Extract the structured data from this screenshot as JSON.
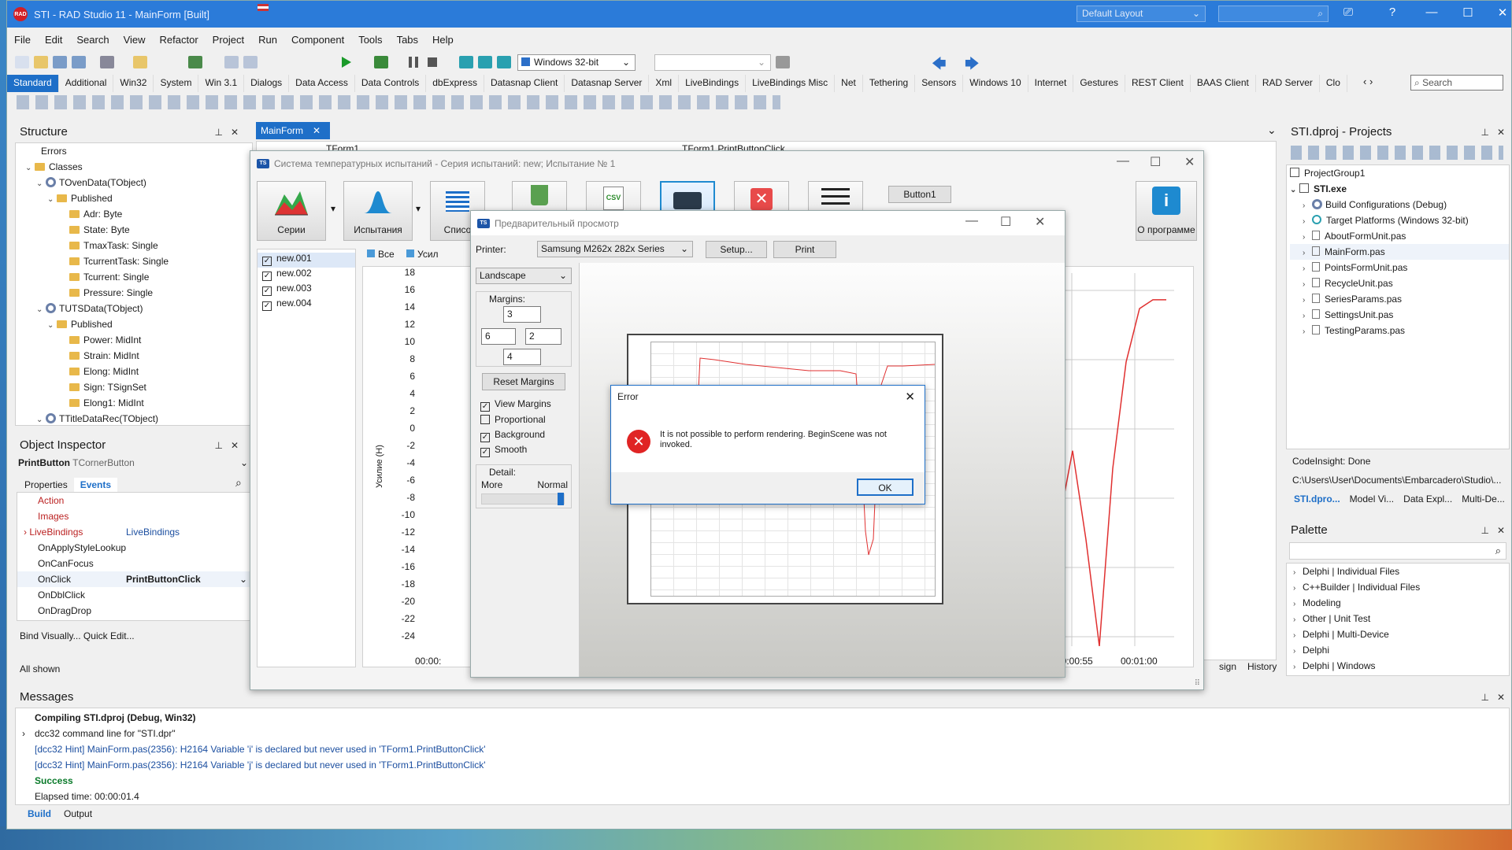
{
  "title": {
    "app": "STI - RAD Studio 11 - MainForm [Built]",
    "layout": "Default Layout",
    "logo": "RAD"
  },
  "menu": [
    "File",
    "Edit",
    "Search",
    "View",
    "Refactor",
    "Project",
    "Run",
    "Component",
    "Tools",
    "Tabs",
    "Help"
  ],
  "toolbar": {
    "platform": "Windows 32-bit",
    "search_placeholder": "Search"
  },
  "palette_tabs": [
    "Standard",
    "Additional",
    "Win32",
    "System",
    "Win 3.1",
    "Dialogs",
    "Data Access",
    "Data Controls",
    "dbExpress",
    "Datasnap Client",
    "Datasnap Server",
    "Xml",
    "LiveBindings",
    "LiveBindings Misc",
    "Net",
    "Tethering",
    "Sensors",
    "Windows 10",
    "Internet",
    "Gestures",
    "REST Client",
    "BAAS Client",
    "RAD Server",
    "Clo"
  ],
  "structure": {
    "title": "Structure",
    "items": [
      "Errors",
      "Classes",
      "TOvenData(TObject)",
      "Published",
      "Adr: Byte",
      "State: Byte",
      "TmaxTask: Single",
      "TcurrentTask: Single",
      "Tcurrent: Single",
      "Pressure: Single",
      "TUTSData(TObject)",
      "Published",
      "Power: MidInt",
      "Strain: MidInt",
      "Elong: MidInt",
      "Sign: TSignSet",
      "Elong1: MidInt",
      "TTitleDataRec(TObject)"
    ]
  },
  "inspector": {
    "title": "Object Inspector",
    "object": "PrintButton",
    "type": "TCornerButton",
    "tab_properties": "Properties",
    "tab_events": "Events",
    "rows": [
      {
        "name": "Action",
        "value": ""
      },
      {
        "name": "Images",
        "value": ""
      },
      {
        "name": "LiveBindings",
        "value": "LiveBindings"
      },
      {
        "name": "OnApplyStyleLookup",
        "value": ""
      },
      {
        "name": "OnCanFocus",
        "value": ""
      },
      {
        "name": "OnClick",
        "value": "PrintButtonClick"
      },
      {
        "name": "OnDblClick",
        "value": ""
      },
      {
        "name": "OnDragDrop",
        "value": ""
      }
    ],
    "bind": "Bind Visually... Quick Edit...",
    "shown": "All shown"
  },
  "editor": {
    "tab": "MainForm",
    "combo1": "TForm1",
    "combo2": "TForm1.PrintButtonClick",
    "bottom_tabs": [
      "sign",
      "History"
    ],
    "times": [
      "00:00:55",
      "00:01:00"
    ]
  },
  "app_window": {
    "title": "Система температурных испытаний - Серия испытаний: new; Испытание № 1",
    "buttons": {
      "series": "Серии",
      "tests": "Испытания",
      "list": "Списо",
      "about": "О программе",
      "button1": "Button1"
    },
    "files": [
      "new.001",
      "new.002",
      "new.003",
      "new.004"
    ],
    "tab_all": "Все",
    "tab_force": "Усил",
    "y_axis_label": "Усилие (Н)",
    "y_ticks": [
      "18",
      "16",
      "14",
      "12",
      "10",
      "8",
      "6",
      "4",
      "2",
      "0",
      "-2",
      "-4",
      "-6",
      "-8",
      "-10",
      "-12",
      "-14",
      "-16",
      "-18",
      "-20",
      "-22",
      "-24"
    ],
    "x_first": "00:00:"
  },
  "preview": {
    "title": "Предварительный просмотр",
    "printer_label": "Printer:",
    "printer": "Samsung M262x 282x Series",
    "setup": "Setup...",
    "print": "Print",
    "orientation": "Landscape",
    "margins_label": "Margins:",
    "m_top": "3",
    "m_left": "6",
    "m_right": "2",
    "m_bottom": "4",
    "reset": "Reset Margins",
    "view_margins": "View Margins",
    "proportional": "Proportional",
    "background": "Background",
    "smooth": "Smooth",
    "detail": "Detail:",
    "more": "More",
    "normal": "Normal"
  },
  "error": {
    "title": "Error",
    "message": "It is not possible to perform rendering. BeginScene was not invoked.",
    "ok": "OK"
  },
  "projects": {
    "title": "STI.dproj - Projects",
    "items": [
      "ProjectGroup1",
      "STI.exe",
      "Build Configurations (Debug)",
      "Target Platforms (Windows 32-bit)",
      "AboutFormUnit.pas",
      "MainForm.pas",
      "PointsFormUnit.pas",
      "RecycleUnit.pas",
      "SeriesParams.pas",
      "SettingsUnit.pas",
      "TestingParams.pas"
    ],
    "status": "CodeInsight: Done",
    "path": "C:\\Users\\User\\Documents\\Embarcadero\\Studio\\...",
    "tabs": [
      "STI.dpro...",
      "Model Vi...",
      "Data Expl...",
      "Multi-De..."
    ]
  },
  "right_palette": {
    "title": "Palette",
    "items": [
      "Delphi | Individual Files",
      "C++Builder | Individual Files",
      "Modeling",
      "Other | Unit Test",
      "Delphi | Multi-Device",
      "Delphi",
      "Delphi | Windows"
    ]
  },
  "messages": {
    "title": "Messages",
    "lines": [
      "Compiling STI.dproj (Debug, Win32)",
      "dcc32 command line for \"STI.dpr\"",
      "[dcc32 Hint] MainForm.pas(2356): H2164 Variable 'i' is declared but never used in 'TForm1.PrintButtonClick'",
      "[dcc32 Hint] MainForm.pas(2356): H2164 Variable 'j' is declared but never used in 'TForm1.PrintButtonClick'",
      "Success",
      "Elapsed time: 00:00:01.4"
    ],
    "tabs": [
      "Build",
      "Output"
    ]
  },
  "colors": {
    "accent": "#1e6fc8",
    "title_bar": "#2b7bd9",
    "error_red": "#e02424",
    "plot_line": "#e03030"
  },
  "chart_data": {
    "type": "line",
    "series": [
      {
        "values": [
          -24,
          -20,
          -10,
          -2,
          -12,
          -24,
          -4,
          8,
          14,
          15,
          15
        ]
      }
    ],
    "ylim": [
      -24,
      18
    ]
  }
}
